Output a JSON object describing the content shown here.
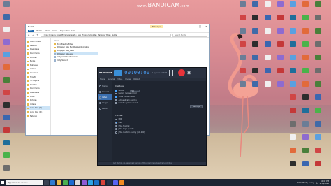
{
  "watermark": {
    "www": "www.",
    "brand": "BANDICAM",
    "tld": ".com"
  },
  "desktop_icons": [
    {
      "label": "",
      "color": "#6b7d96"
    },
    {
      "label": "",
      "color": "#3f6aa8"
    },
    {
      "label": "",
      "color": "#f0f0f0"
    },
    {
      "label": "",
      "color": "#8e6bd0"
    },
    {
      "label": "",
      "color": "#5aa0e0"
    },
    {
      "label": "",
      "color": "#e26a3a"
    },
    {
      "label": "",
      "color": "#4a7f3a"
    },
    {
      "label": "",
      "color": "#d04545"
    },
    {
      "label": "",
      "color": "#2d2d2d"
    },
    {
      "label": "",
      "color": "#3a66b0"
    },
    {
      "label": "",
      "color": "#c43838"
    },
    {
      "label": "",
      "color": "#1f6e9a"
    },
    {
      "label": "",
      "color": "#4ab34a"
    },
    {
      "label": "",
      "color": "#6d6d6d"
    }
  ],
  "explorer": {
    "title": "Builds",
    "ribbon_tabs": [
      "File",
      "Home",
      "Share",
      "View",
      "Application Tools"
    ],
    "manage_tab": "Manage",
    "path": "« Unity Projects › Alex Physics template › Alex Physics template › Mallpaper Bike › Builds",
    "search_placeholder": "Search Builds",
    "nav_items": [
      "Quick access",
      "Desktop",
      "Downloads",
      "Documents",
      "Pictures",
      "Builds",
      "Mallpaper",
      "Videos",
      "OneDrive",
      "This PC",
      "3D Objects",
      "Desktop",
      "Documents",
      "Downloads",
      "Music",
      "Pictures",
      "Videos",
      "Local Disk (C:)",
      "Local Disk (D:)",
      "Network"
    ],
    "selected_nav": 17,
    "column_name": "Name",
    "files": [
      {
        "name": "MonoBleedingEdge",
        "type": "folder"
      },
      {
        "name": "Wallpaper Bike_BurstDebugInformation",
        "type": "folder"
      },
      {
        "name": "Wallpaper Bike_Data",
        "type": "folder"
      },
      {
        "name": "Wallpaper Bike.exe",
        "type": "file"
      },
      {
        "name": "UnityCrashHandler64.exe",
        "type": "file"
      },
      {
        "name": "UnityPlayer.dll",
        "type": "file"
      }
    ],
    "selected_file": 3
  },
  "bandicam": {
    "logo": "BANDICAM",
    "timer": "00:00:00",
    "size": "0 bytes / 14.2GB",
    "sub_items": [
      "Home",
      "General",
      "Video",
      "Image",
      "Output"
    ],
    "sidebar": [
      "Home",
      "General",
      "Video",
      "Image",
      "About"
    ],
    "active_sidebar": 2,
    "capture_title": "Capture",
    "capture_rows": [
      {
        "label": "Hotkey",
        "checked": true,
        "field": "F12"
      },
      {
        "label": "Record mouse cursor",
        "checked": false
      },
      {
        "label": "Show mouse cursor",
        "checked": true
      },
      {
        "label": "Add webcam overlay",
        "checked": false
      },
      {
        "label": "Include system sound",
        "checked": false
      }
    ],
    "settings_btn": "Settings",
    "format_title": "Format",
    "format_rows": [
      {
        "label": "BMP",
        "on": false
      },
      {
        "label": "PNG",
        "on": true
      },
      {
        "label": "JPG - Normal",
        "on": false
      },
      {
        "label": "JPG - High quality",
        "on": false
      },
      {
        "label": "JPG - Custom quality (10..100)",
        "on": false
      }
    ],
    "footer": "Get the full, no-watermark version of Bandicam here: bandicam.com/buy"
  },
  "taskbar": {
    "search_placeholder": "Type here to search",
    "apps": [
      {
        "name": "task-view",
        "color": "#3a4252"
      },
      {
        "name": "edge",
        "color": "#2e7ad1"
      },
      {
        "name": "explorer",
        "color": "#e8b94a"
      },
      {
        "name": "chrome",
        "color": "#4caf50"
      },
      {
        "name": "store",
        "color": "#1c6bd1"
      },
      {
        "name": "unity",
        "color": "#dcdcdc"
      },
      {
        "name": "vs",
        "color": "#8e5bd6"
      },
      {
        "name": "photoshop",
        "color": "#2ea4e6"
      },
      {
        "name": "mail",
        "color": "#1a73c9"
      },
      {
        "name": "bandicam",
        "color": "#d8433b"
      },
      {
        "name": "steam",
        "color": "#22324a"
      },
      {
        "name": "discord",
        "color": "#5865f2"
      },
      {
        "name": "vlc",
        "color": "#f28b22"
      }
    ],
    "weather": "27°C Mostly sunny",
    "time": "10:47 PM",
    "date": "4/18/2023"
  }
}
